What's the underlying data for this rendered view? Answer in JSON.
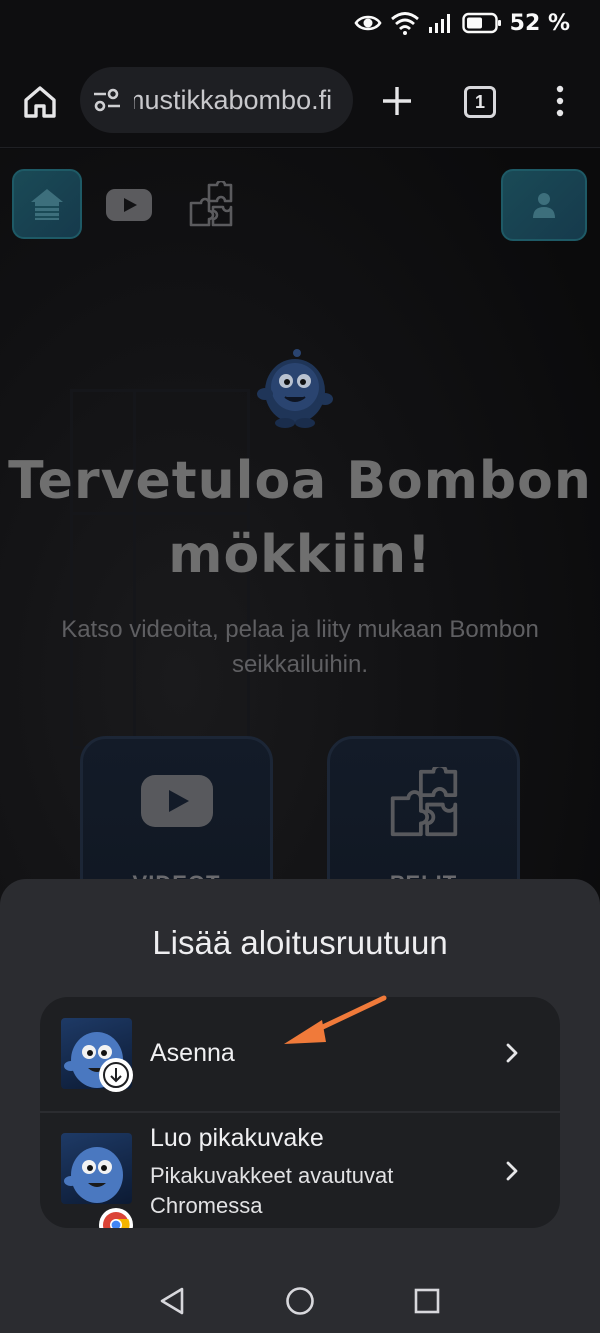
{
  "status_bar": {
    "battery_percent_text": "52 %",
    "icons": [
      "eye-icon",
      "wifi-icon",
      "signal-icon",
      "battery-icon"
    ]
  },
  "browser": {
    "url": "mustikkabombo.fi",
    "open_tabs_count": "1",
    "icons": [
      "home-icon",
      "tune-icon",
      "plus-icon",
      "tabs-icon",
      "more-vert-icon"
    ]
  },
  "page": {
    "nav_icons": [
      "cabin-icon",
      "video-icon",
      "puzzle-icon",
      "user-icon"
    ],
    "hero_title_line1": "Tervetuloa Bombon",
    "hero_title_line2": "mökkiin!",
    "hero_subtitle_line1": "Katso videoita, pelaa ja liity mukaan Bombon",
    "hero_subtitle_line2": "seikkailuihin.",
    "cards": [
      {
        "label": "VIDEOT",
        "icon": "video-icon"
      },
      {
        "label": "PELIT",
        "icon": "puzzle-icon"
      }
    ]
  },
  "sheet": {
    "title": "Lisää aloitusruutuun",
    "options": [
      {
        "title": "Asenna",
        "badge_icon": "download-icon"
      },
      {
        "title": "Luo pikakuvake",
        "subtitle_line1": "Pikakuvakkeet avautuvat",
        "subtitle_line2": "Chromessa",
        "badge_icon": "chrome-icon"
      }
    ],
    "annotation_arrow_color": "#f07a3a"
  },
  "system_nav": {
    "icons": [
      "back-icon",
      "home-circle-icon",
      "recents-icon"
    ]
  },
  "colors": {
    "sheet_background": "#2b2c30",
    "options_background": "#1e1f22",
    "accent_teal": "#1a4a56"
  }
}
